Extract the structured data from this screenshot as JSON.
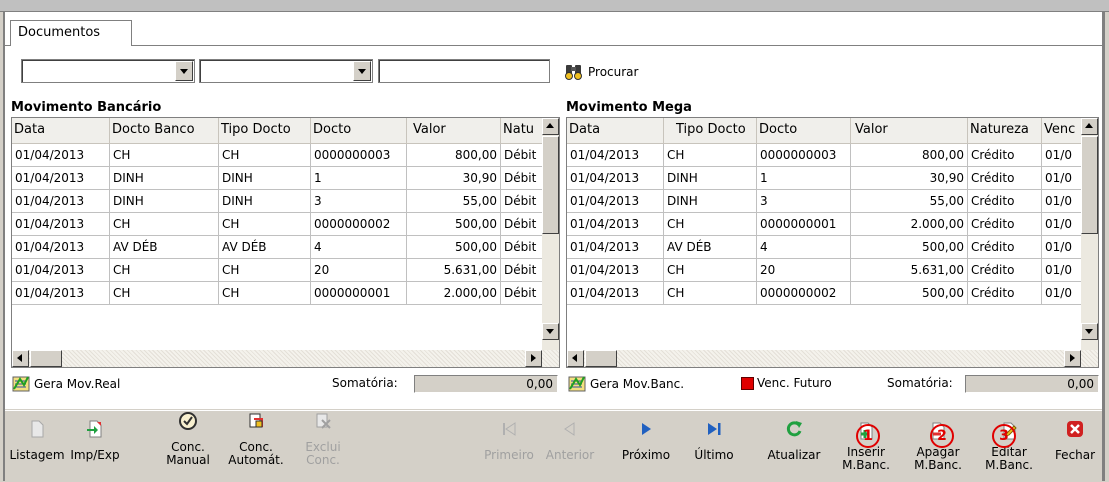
{
  "tab": {
    "label": "Documentos"
  },
  "filters": {
    "combo1": "",
    "combo2": "",
    "search_text": ""
  },
  "procurar": {
    "label": "Procurar",
    "icon": "binoculars-icon"
  },
  "left_panel": {
    "title": "Movimento Bancário",
    "columns": [
      "Data",
      "Docto Banco",
      "Tipo Docto",
      "Docto",
      "Valor",
      "Natu"
    ],
    "rows": [
      [
        "01/04/2013",
        "CH",
        "CH",
        "0000000003",
        "800,00",
        "Débit"
      ],
      [
        "01/04/2013",
        "DINH",
        "DINH",
        "1",
        "30,90",
        "Débit"
      ],
      [
        "01/04/2013",
        "DINH",
        "DINH",
        "3",
        "55,00",
        "Débit"
      ],
      [
        "01/04/2013",
        "CH",
        "CH",
        "0000000002",
        "500,00",
        "Débit"
      ],
      [
        "01/04/2013",
        "AV DÉB",
        "AV DÉB",
        "4",
        "500,00",
        "Débit"
      ],
      [
        "01/04/2013",
        "CH",
        "CH",
        "20",
        "5.631,00",
        "Débit"
      ],
      [
        "01/04/2013",
        "CH",
        "CH",
        "0000000001",
        "2.000,00",
        "Débit"
      ]
    ],
    "gera_label": "Gera Mov.Real",
    "somatoria_label": "Somatória:",
    "somatoria_value": "0,00"
  },
  "right_panel": {
    "title": "Movimento Mega",
    "columns": [
      "Data",
      "Tipo Docto",
      "Docto",
      "Valor",
      "Natureza",
      "Venc"
    ],
    "rows": [
      [
        "01/04/2013",
        "CH",
        "0000000003",
        "800,00",
        "Crédito",
        "01/0"
      ],
      [
        "01/04/2013",
        "DINH",
        "1",
        "30,90",
        "Crédito",
        "01/0"
      ],
      [
        "01/04/2013",
        "DINH",
        "3",
        "55,00",
        "Crédito",
        "01/0"
      ],
      [
        "01/04/2013",
        "CH",
        "0000000001",
        "2.000,00",
        "Crédito",
        "01/0"
      ],
      [
        "01/04/2013",
        "AV DÉB",
        "4",
        "500,00",
        "Crédito",
        "01/0"
      ],
      [
        "01/04/2013",
        "CH",
        "20",
        "5.631,00",
        "Crédito",
        "01/0"
      ],
      [
        "01/04/2013",
        "CH",
        "0000000002",
        "500,00",
        "Crédito",
        "01/0"
      ]
    ],
    "gera_label": "Gera Mov.Banc.",
    "venc_futuro_label": "Venc. Futuro",
    "venc_futuro_color": "#e00000",
    "somatoria_label": "Somatória:",
    "somatoria_value": "0,00"
  },
  "toolbar": {
    "listagem": "Listagem",
    "imp_exp": "Imp/Exp",
    "conc_manual_1": "Conc.",
    "conc_manual_2": "Manual",
    "conc_autom_1": "Conc.",
    "conc_autom_2": "Automát.",
    "exclui_conc_1": "Exclui",
    "exclui_conc_2": "Conc.",
    "primeiro": "Primeiro",
    "anterior": "Anterior",
    "proximo": "Próximo",
    "ultimo": "Último",
    "atualizar": "Atualizar",
    "inserir_1": "Inserir",
    "inserir_2": "M.Banc.",
    "apagar_1": "Apagar",
    "apagar_2": "M.Banc.",
    "editar_1": "Editar",
    "editar_2": "M.Banc.",
    "fechar": "Fechar"
  },
  "markers": [
    "1",
    "2",
    "3"
  ],
  "colors": {
    "nav_blue": "#2060c0",
    "refresh_green": "#20a040",
    "close_red": "#d02020",
    "marker_red": "#e00000"
  }
}
